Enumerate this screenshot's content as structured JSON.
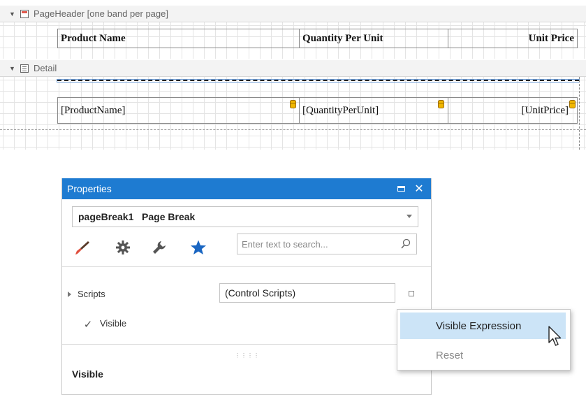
{
  "designer": {
    "page_header_band": {
      "label": "PageHeader [one band per page]",
      "icon": "page-header-band-icon"
    },
    "header_cells": [
      "Product Name",
      "Quantity Per Unit",
      "Unit Price"
    ],
    "detail_band": {
      "label": "Detail",
      "icon": "detail-band-icon"
    },
    "detail_cells": [
      "[ProductName]",
      "[QuantityPerUnit]",
      "[UnitPrice]"
    ]
  },
  "properties_panel": {
    "title": "Properties",
    "selected_object": "pageBreak1   Page Break",
    "tabs": [
      "paintbrush-icon",
      "gear-icon",
      "wrench-icon",
      "star-icon"
    ],
    "search_placeholder": "Enter text to search...",
    "rows": {
      "scripts": {
        "name": "Scripts",
        "value": "(Control Scripts)"
      },
      "visible": {
        "name": "Visible",
        "checked": true
      }
    },
    "description_title": "Visible"
  },
  "context_menu": {
    "items": [
      {
        "label": "Visible Expression",
        "highlighted": true
      },
      {
        "label": "Reset",
        "disabled": true
      }
    ]
  },
  "colors": {
    "accent": "#1e7bd1",
    "highlight": "#cce4f7"
  }
}
